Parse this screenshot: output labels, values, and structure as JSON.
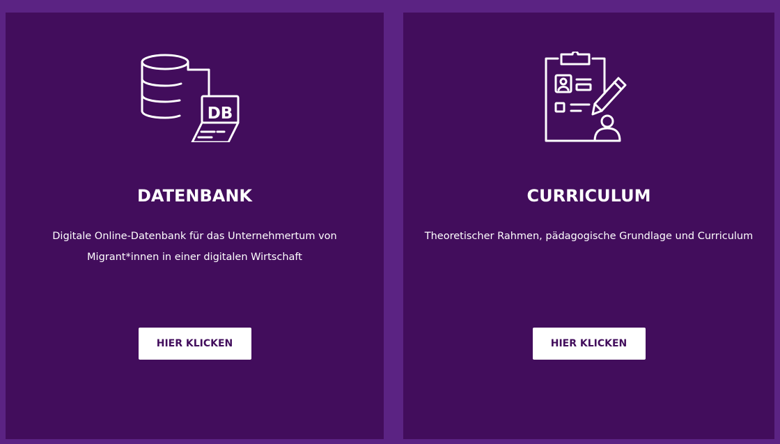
{
  "colors": {
    "background": "#5b2383",
    "card": "#420d5c",
    "button_bg": "#ffffff",
    "button_text": "#420d5c",
    "text": "#ffffff"
  },
  "cards": [
    {
      "icon": "database-laptop-icon",
      "title": "DATENBANK",
      "description": "Digitale Online-Datenbank für das Unternehmertum von Migrant*innen in einer digitalen Wirtschaft",
      "button_label": "HIER KLICKEN",
      "icon_text": "DB"
    },
    {
      "icon": "clipboard-pen-person-icon",
      "title": "CURRICULUM",
      "description": "Theoretischer Rahmen, pädagogische Grundlage und Curriculum",
      "button_label": "HIER KLICKEN"
    }
  ]
}
